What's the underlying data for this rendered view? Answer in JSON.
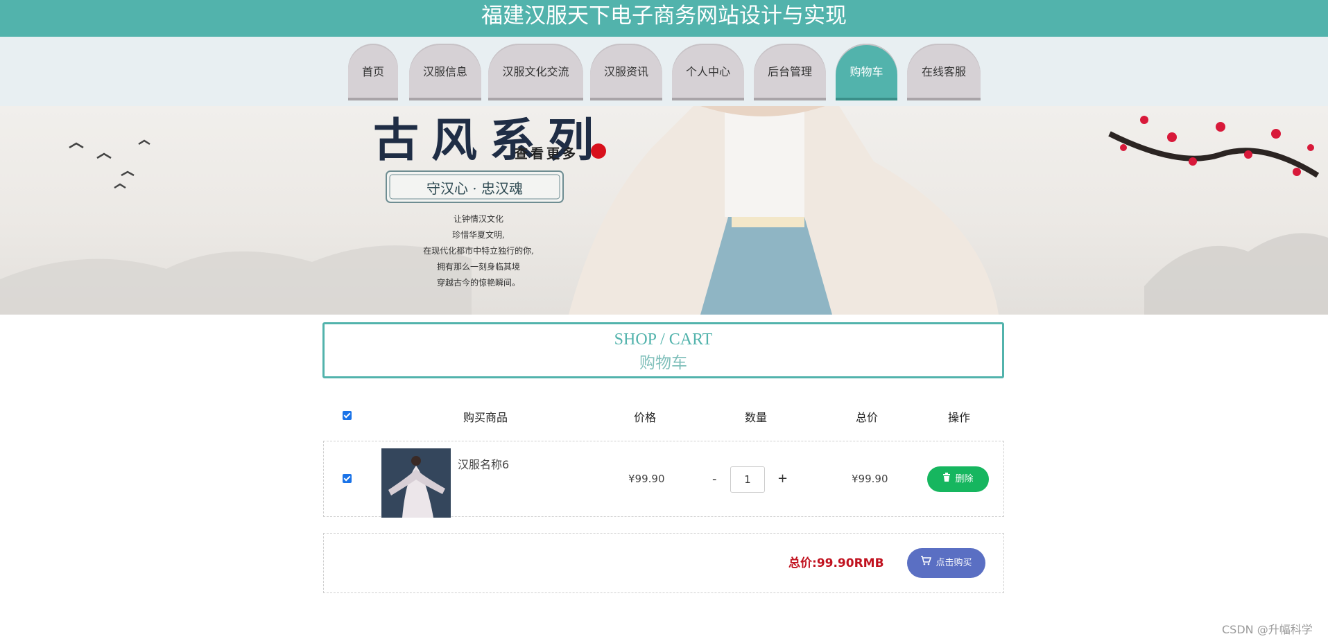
{
  "site": {
    "title": "福建汉服天下电子商务网站设计与实现"
  },
  "nav": {
    "items": [
      "首页",
      "汉服信息",
      "汉服文化交流",
      "汉服资讯",
      "个人中心",
      "后台管理",
      "购物车",
      "在线客服"
    ],
    "active": "购物车",
    "active_color": "#52b3ac"
  },
  "banner": {
    "headline": "古风系列",
    "more": "查看更多",
    "slogan": "守汉心 · 忠汉魂",
    "lines": [
      "让钟情汉文化",
      "珍惜华夏文明,",
      "在现代化都市中特立独行的你,",
      "拥有那么一刻身临其境",
      "穿越古今的惊艳瞬间。"
    ]
  },
  "cart": {
    "title_en": "SHOP / CART",
    "title_cn": "购物车",
    "headers": [
      "购买商品",
      "价格",
      "数量",
      "总价",
      "操作"
    ],
    "items": [
      {
        "name": "汉服名称6",
        "price": "¥99.90",
        "quantity": "1",
        "total": "¥99.90",
        "delete_label": "删除",
        "checked": true
      }
    ],
    "select_all_checked": true,
    "summary": {
      "total_label": "总价:",
      "total_value": "99.90RMB",
      "buy_label": "点击购买"
    },
    "qty_minus": "-",
    "qty_plus": "+"
  },
  "watermark": "CSDN @升幅科学",
  "colors": {
    "header": "#52b3ac",
    "delete": "#16b65f",
    "buy": "#5a6fc3",
    "total": "#c1121f"
  }
}
